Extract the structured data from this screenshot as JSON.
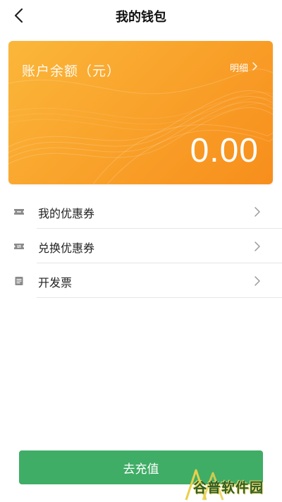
{
  "header": {
    "title": "我的钱包",
    "back_icon": "chevron-left-icon"
  },
  "wallet_card": {
    "balance_label": "账户余额（元）",
    "detail_label": "明细",
    "balance_value": "0.00",
    "gradient_colors": [
      "#fbb73a",
      "#f78e1c"
    ]
  },
  "menu": {
    "items": [
      {
        "label": "我的优惠券",
        "icon": "coupon-icon"
      },
      {
        "label": "兑换优惠券",
        "icon": "exchange-coupon-icon"
      },
      {
        "label": "开发票",
        "icon": "invoice-icon"
      }
    ]
  },
  "actions": {
    "recharge_label": "去充值",
    "recharge_color": "#3fad66"
  },
  "watermark": {
    "text": "谷普软件园"
  }
}
